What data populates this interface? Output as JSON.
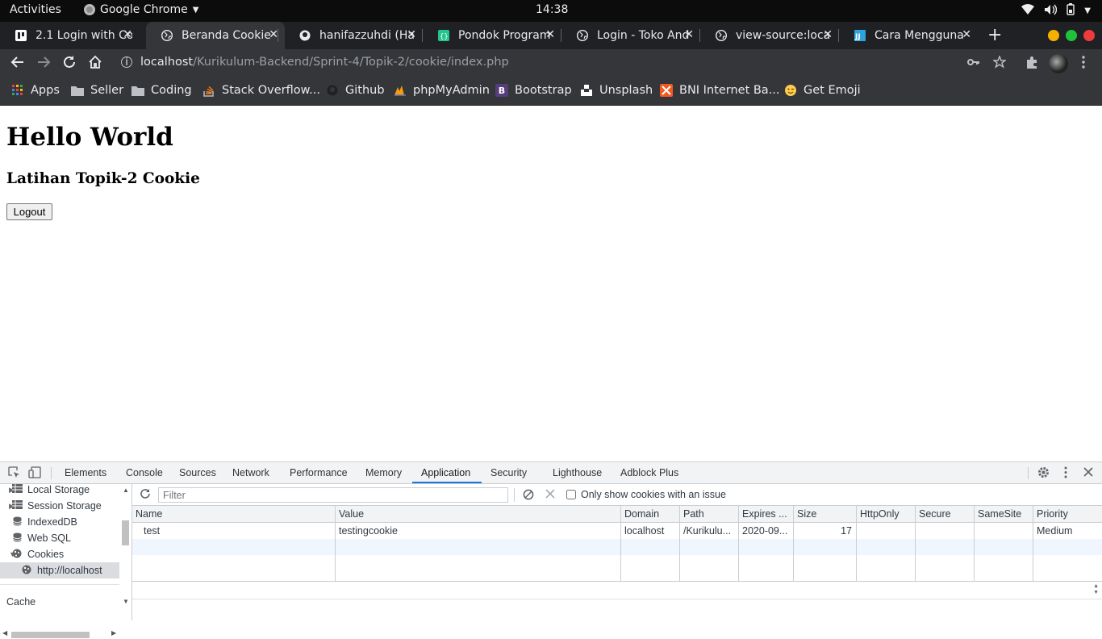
{
  "system_bar": {
    "activities": "Activities",
    "app_name": "Google Chrome",
    "clock": "14:38"
  },
  "tabs": [
    {
      "title": "2.1 Login with Co",
      "active": false,
      "icon": "trello-icon",
      "icon_color": "#ffffff"
    },
    {
      "title": "Beranda Cookie",
      "active": true,
      "icon": "globe-icon",
      "icon_color": "#e8eaed"
    },
    {
      "title": "hanifazzuhdi (Ha",
      "active": false,
      "icon": "github-icon",
      "icon_color": "#e8eaed"
    },
    {
      "title": "Pondok Program",
      "active": false,
      "icon": "pondok-icon",
      "icon_color": "#23c48e"
    },
    {
      "title": "Login - Toko And",
      "active": false,
      "icon": "globe-icon",
      "icon_color": "#e8eaed"
    },
    {
      "title": "view-source:loca",
      "active": false,
      "icon": "globe-icon",
      "icon_color": "#e8eaed"
    },
    {
      "title": "Cara Mengguna",
      "active": false,
      "icon": "jj-icon",
      "icon_color": "#2fa3de"
    }
  ],
  "address_bar": {
    "host": "localhost",
    "path": "/Kurikulum-Backend/Sprint-4/Topik-2/cookie/index.php"
  },
  "bookmarks": [
    {
      "label": "Apps",
      "icon": "apps-grid-icon"
    },
    {
      "label": "Seller",
      "icon": "folder-icon"
    },
    {
      "label": "Coding",
      "icon": "folder-icon"
    },
    {
      "label": "Stack Overflow...",
      "icon": "stackoverflow-icon"
    },
    {
      "label": "Github",
      "icon": "github-icon"
    },
    {
      "label": "phpMyAdmin",
      "icon": "phpmyadmin-icon"
    },
    {
      "label": "Bootstrap",
      "icon": "bootstrap-icon"
    },
    {
      "label": "Unsplash",
      "icon": "unsplash-icon"
    },
    {
      "label": "BNI Internet Ba...",
      "icon": "bni-icon"
    },
    {
      "label": "Get Emoji",
      "icon": "emoji-icon"
    }
  ],
  "page": {
    "heading": "Hello World",
    "subheading": "Latihan Topik-2 Cookie",
    "logout_button": "Logout"
  },
  "devtools": {
    "tabs": [
      "Elements",
      "Console",
      "Sources",
      "Network",
      "Performance",
      "Memory",
      "Application",
      "Security",
      "Lighthouse",
      "Adblock Plus"
    ],
    "active_tab": "Application",
    "sidebar": [
      {
        "label": "Local Storage",
        "icon": "grid-icon",
        "expanded": false
      },
      {
        "label": "Session Storage",
        "icon": "grid-icon",
        "expanded": false
      },
      {
        "label": "IndexedDB",
        "icon": "database-icon",
        "expanded": null
      },
      {
        "label": "Web SQL",
        "icon": "database-icon",
        "expanded": null
      },
      {
        "label": "Cookies",
        "icon": "cookie-icon",
        "expanded": true
      },
      {
        "label": "http://localhost",
        "icon": "cookie-icon",
        "selected": true
      }
    ],
    "sidebar_section": "Cache",
    "filter_placeholder": "Filter",
    "only_issues_label": "Only show cookies with an issue",
    "columns": [
      "Name",
      "Value",
      "Domain",
      "Path",
      "Expires ...",
      "Size",
      "HttpOnly",
      "Secure",
      "SameSite",
      "Priority"
    ],
    "rows": [
      {
        "name": "test",
        "value": "testingcookie",
        "domain": "localhost",
        "path": "/Kurikulu...",
        "expires": "2020-09...",
        "size": "17",
        "httponly": "",
        "secure": "",
        "samesite": "",
        "priority": "Medium"
      }
    ]
  }
}
